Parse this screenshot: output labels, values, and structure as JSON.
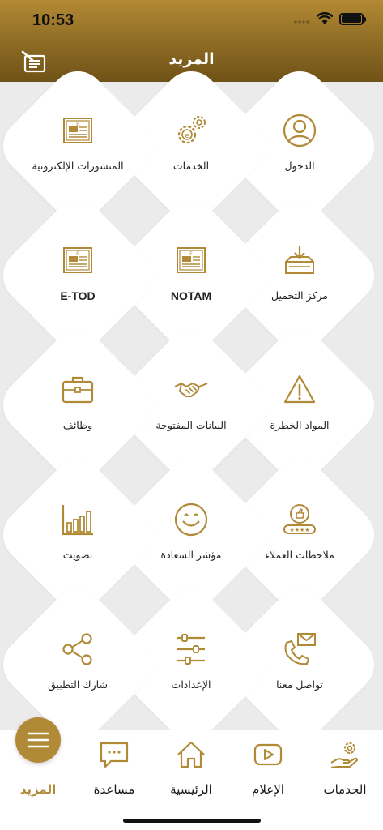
{
  "status": {
    "time": "10:53"
  },
  "header": {
    "title": "المزيد"
  },
  "colors": {
    "gold": "#b08a36",
    "header_dark": "#6f5217",
    "background": "#ebebeb"
  },
  "grid": {
    "items": [
      {
        "label": "الدخول",
        "icon": "user-icon"
      },
      {
        "label": "الخدمات",
        "icon": "e-services-gears-icon"
      },
      {
        "label": "المنشورات الإلكترونية",
        "icon": "newspaper-icon"
      },
      {
        "label": "مركز التحميل",
        "icon": "download-tray-icon"
      },
      {
        "label": "NOTAM",
        "icon": "newspaper-icon"
      },
      {
        "label": "E-TOD",
        "icon": "newspaper-icon"
      },
      {
        "label": "المواد الخطرة",
        "icon": "warning-icon"
      },
      {
        "label": "البيانات المفتوحة",
        "icon": "handshake-icon"
      },
      {
        "label": "وظائف",
        "icon": "briefcase-icon"
      },
      {
        "label": "ملاحظات العملاء",
        "icon": "feedback-rating-icon"
      },
      {
        "label": "مؤشر السعادة",
        "icon": "smiley-icon"
      },
      {
        "label": "تصويت",
        "icon": "bar-chart-icon"
      },
      {
        "label": "تواصل معنا",
        "icon": "phone-mail-icon"
      },
      {
        "label": "الإعدادات",
        "icon": "sliders-icon"
      },
      {
        "label": "شارك التطبيق",
        "icon": "share-icon"
      }
    ]
  },
  "tabbar": {
    "items": [
      {
        "label": "الخدمات",
        "icon": "hand-gear-icon",
        "active": false
      },
      {
        "label": "الإعلام",
        "icon": "play-media-icon",
        "active": false
      },
      {
        "label": "الرئيسية",
        "icon": "home-icon",
        "active": false
      },
      {
        "label": "مساعدة",
        "icon": "chat-icon",
        "active": false
      },
      {
        "label": "المزيد",
        "icon": "menu-icon",
        "active": true
      }
    ]
  }
}
